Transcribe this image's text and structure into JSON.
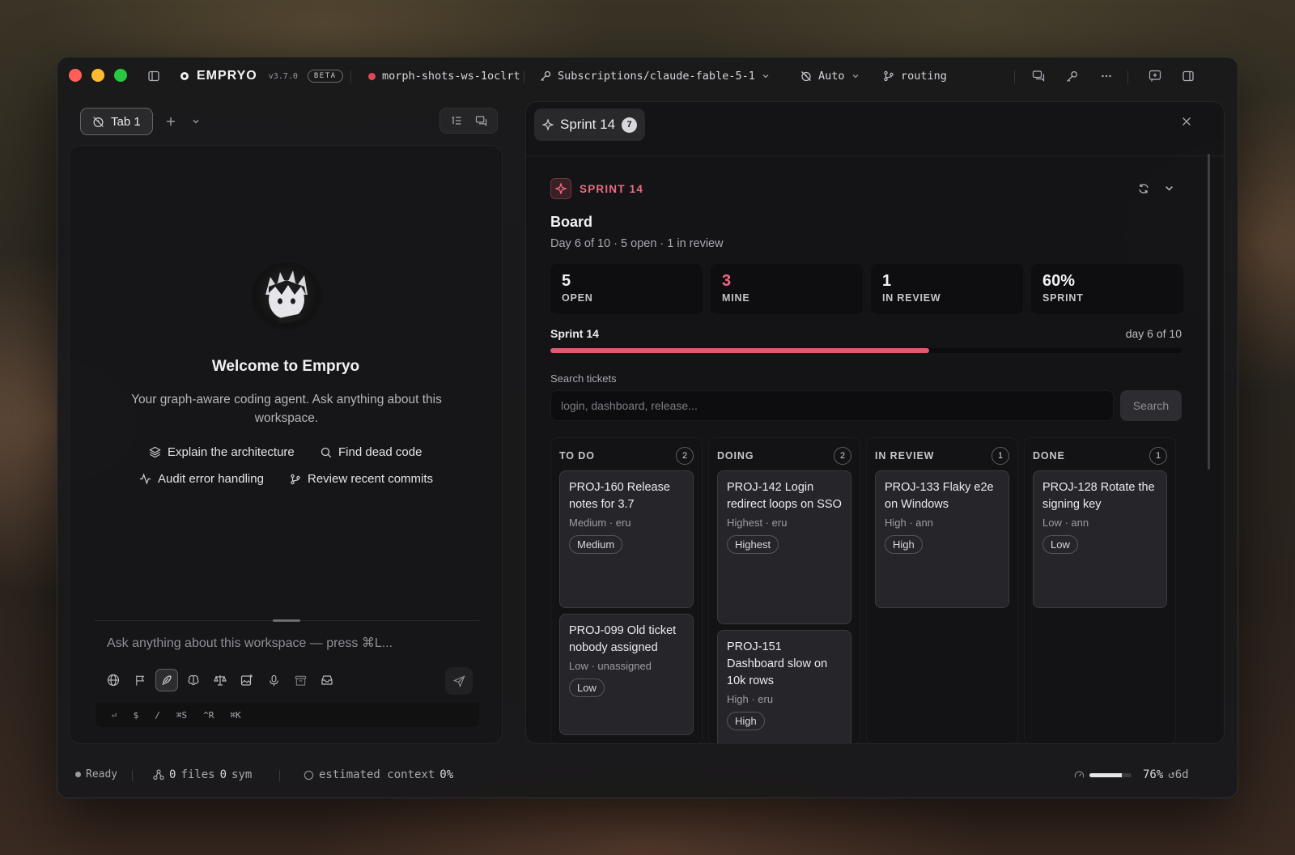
{
  "titlebar": {
    "app_name": "EMPRYO",
    "version": "v3.7.0",
    "beta": "BETA",
    "workspace": "morph-shots-ws-1oclrt",
    "model_path": "Subscriptions/claude-fable-5-1",
    "mode": "Auto",
    "routing": "routing"
  },
  "left": {
    "tab_label": "Tab 1",
    "welcome_title": "Welcome to Empryo",
    "welcome_subtitle": "Your graph-aware coding agent. Ask anything about this workspace.",
    "suggestions": [
      "Explain the architecture",
      "Find dead code",
      "Audit error handling",
      "Review recent commits"
    ],
    "composer_placeholder": "Ask anything about this workspace — press ⌘L...",
    "shortcuts": [
      "⏎",
      "$",
      "/",
      "⌘S",
      "^R",
      "⌘K"
    ]
  },
  "right": {
    "tab_label": "Sprint 14",
    "tab_count": "7",
    "sprint_label": "SPRINT 14",
    "board_title": "Board",
    "board_subtitle": "Day 6 of 10 · 5 open · 1 in review",
    "stats": [
      {
        "value": "5",
        "label": "OPEN",
        "color": "#f2f2f4"
      },
      {
        "value": "3",
        "label": "MINE",
        "color": "#ec6b80"
      },
      {
        "value": "1",
        "label": "IN REVIEW",
        "color": "#f2f2f4"
      },
      {
        "value": "60%",
        "label": "SPRINT",
        "color": "#f2f2f4"
      }
    ],
    "progress_label": "Sprint 14",
    "progress_day": "day 6 of 10",
    "progress_fraction": 0.6,
    "search_label": "Search tickets",
    "search_placeholder": "login, dashboard, release...",
    "search_button": "Search",
    "columns": [
      {
        "title": "TO DO",
        "count": "2",
        "cards": [
          {
            "title": "PROJ-160 Release notes for 3.7",
            "meta": "Medium · eru",
            "priority": "Medium"
          },
          {
            "title": "PROJ-099 Old ticket nobody assigned",
            "meta": "Low · unassigned",
            "priority": "Low"
          }
        ]
      },
      {
        "title": "DOING",
        "count": "2",
        "cards": [
          {
            "title": "PROJ-142 Login redirect loops on SSO",
            "meta": "Highest · eru",
            "priority": "Highest"
          },
          {
            "title": "PROJ-151 Dashboard slow on 10k rows",
            "meta": "High · eru",
            "priority": "High"
          }
        ]
      },
      {
        "title": "IN REVIEW",
        "count": "1",
        "cards": [
          {
            "title": "PROJ-133 Flaky e2e on Windows",
            "meta": "High · ann",
            "priority": "High"
          }
        ]
      },
      {
        "title": "DONE",
        "count": "1",
        "cards": [
          {
            "title": "PROJ-128 Rotate the signing key",
            "meta": "Low · ann",
            "priority": "Low"
          }
        ]
      }
    ]
  },
  "statusbar": {
    "status": "Ready",
    "files_count": "0",
    "files_label": "files",
    "sym_count": "0",
    "sym_label": "sym",
    "context_label": "estimated context",
    "context_value": "0%",
    "usage_percent": "76%",
    "usage_fraction": 0.76,
    "reset": "↺6d"
  },
  "colors": {
    "accent": "#e05a70",
    "ready_dot": "#9a9aa2",
    "workspace_dot": "#e0485a"
  }
}
